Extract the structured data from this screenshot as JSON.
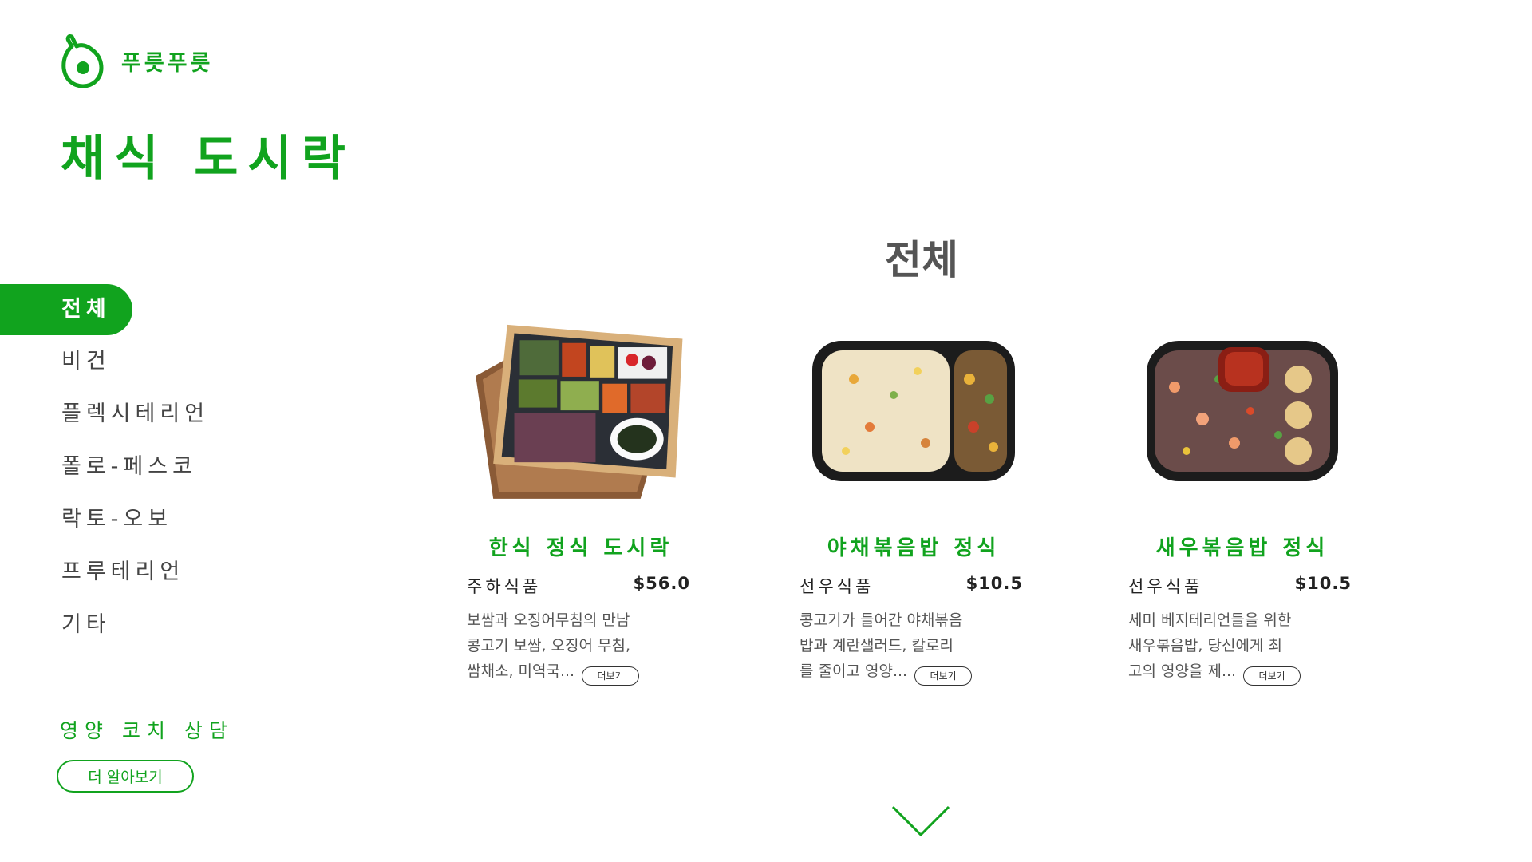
{
  "brand": {
    "name": "푸릇푸릇"
  },
  "page_title": "채식 도시락",
  "sidebar": {
    "items": [
      {
        "label": "전체",
        "active": true
      },
      {
        "label": "비건"
      },
      {
        "label": "플렉시테리언"
      },
      {
        "label": "폴로-페스코"
      },
      {
        "label": "락토-오보"
      },
      {
        "label": "프루테리언"
      },
      {
        "label": "기타"
      }
    ]
  },
  "coach": {
    "title": "영양 코치 상담",
    "button_label": "더 알아보기"
  },
  "section_title": "전체",
  "products": [
    {
      "name": "한식 정식 도시락",
      "seller": "주하식품",
      "price": "$56.0",
      "desc_lines": [
        "보쌈과 오징어무침의 만남",
        "콩고기 보쌈, 오징어 무침,",
        "쌈채소, 미역국..."
      ],
      "more_label": "더보기",
      "image": "korean-bento-box"
    },
    {
      "name": "야채볶음밥 정식",
      "seller": "선우식품",
      "price": "$10.5",
      "desc_lines": [
        "콩고기가 들어간 야채볶음",
        "밥과 계란샐러드, 칼로리",
        "를 줄이고 영양..."
      ],
      "more_label": "더보기",
      "image": "vegetable-fried-rice"
    },
    {
      "name": "새우볶음밥 정식",
      "seller": "선우식품",
      "price": "$10.5",
      "desc_lines": [
        "세미 베지테리언들을 위한",
        "새우볶음밥, 당신에게 최",
        "고의 영양을 제..."
      ],
      "more_label": "더보기",
      "image": "shrimp-fried-rice"
    }
  ],
  "colors": {
    "accent": "#11a31e"
  },
  "icons": {
    "logo": "avocado-icon",
    "scroll": "chevron-down-icon"
  }
}
